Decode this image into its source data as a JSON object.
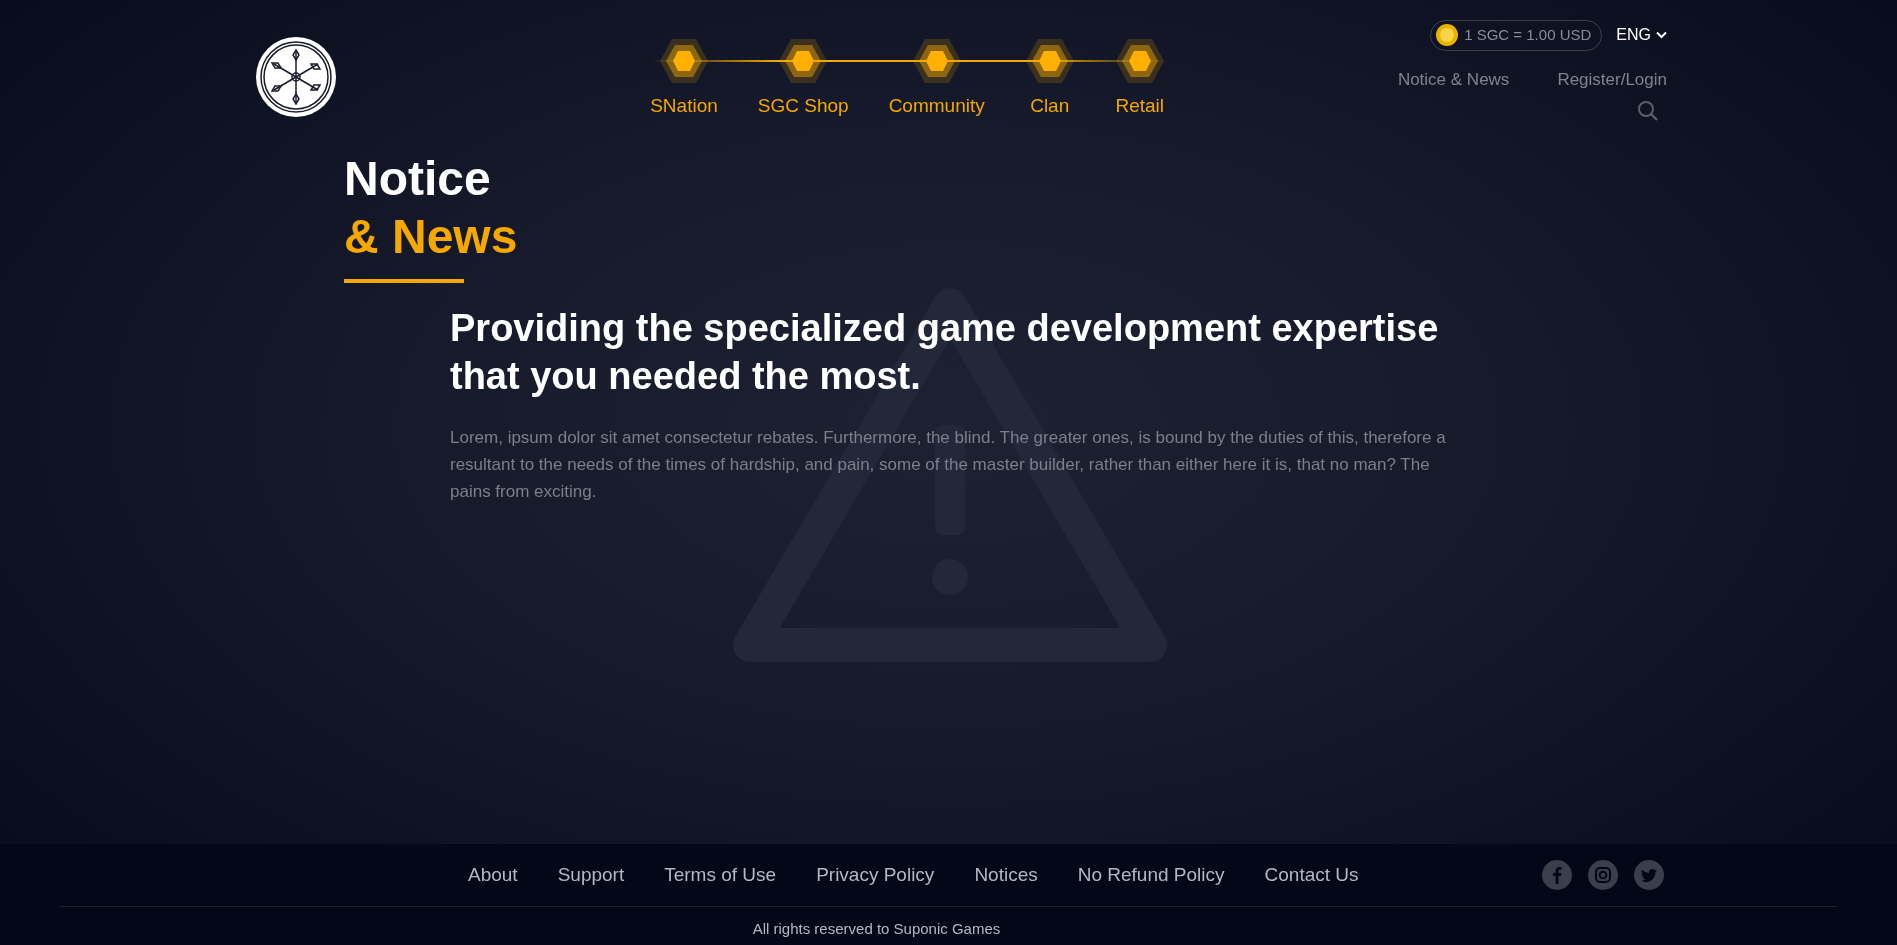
{
  "header": {
    "nav_items": [
      "SNation",
      "SGC Shop",
      "Community",
      "Clan",
      "Retail"
    ],
    "rate": "1 SGC = 1.00 USD",
    "language": "ENG",
    "links": [
      "Notice & News",
      "Register/Login"
    ]
  },
  "page_title": {
    "line1": "Notice",
    "line2": "& News"
  },
  "article": {
    "headline": "Providing the specialized game development expertise that you needed the most.",
    "body": "Lorem, ipsum dolor sit amet consectetur rebates. Furthermore, the blind. The greater ones, is bound by the duties of this, therefore a resultant to the needs of the times of hardship, and pain, some of the master builder, rather than either here it is, that no man? The pains from exciting."
  },
  "footer": {
    "links": [
      "About",
      "Support",
      "Terms of Use",
      "Privacy Policy",
      "Notices",
      "No Refund Policy",
      "Contact Us"
    ],
    "copyright": "All rights reserved to Suponic Games"
  }
}
